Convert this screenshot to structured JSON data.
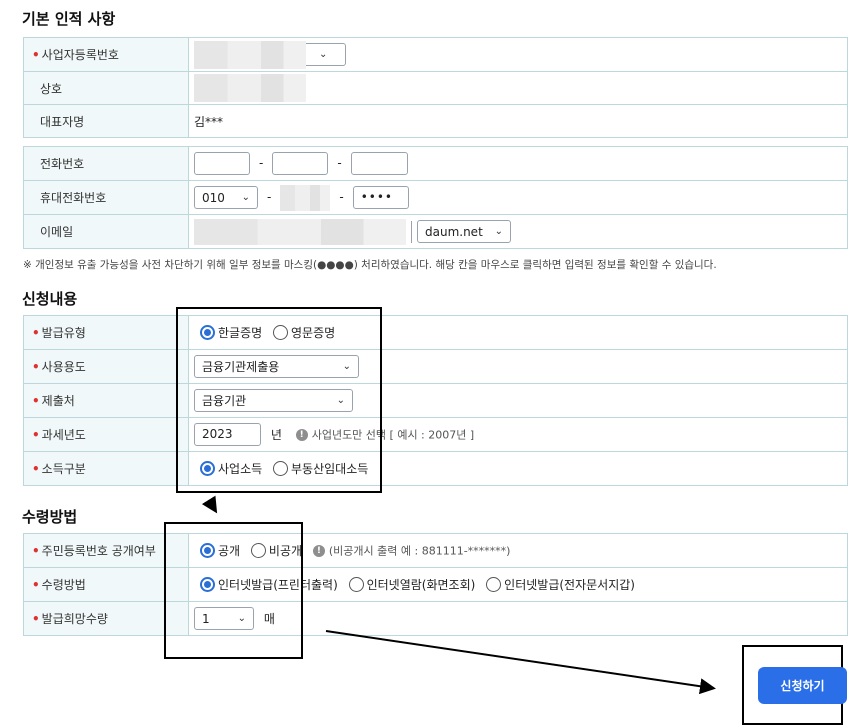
{
  "sections": {
    "basic": "기본 인적 사항",
    "request": "신청내용",
    "receive": "수령방법"
  },
  "basic": {
    "biz_no_label": "사업자등록번호",
    "company_label": "상호",
    "ceo_label": "대표자명",
    "ceo_value": "김***"
  },
  "contact": {
    "phone_label": "전화번호",
    "mobile_label": "휴대전화번호",
    "mobile_prefix": "010",
    "mobile_last": "••••",
    "email_label": "이메일",
    "email_domain": "daum.net",
    "dash": "-"
  },
  "notice": "※ 개인정보 유출 가능성을 사전 차단하기 위해 일부 정보를 마스킹(●●●●) 처리하였습니다. 해당 칸을 마우스로 클릭하면 입력된 정보를 확인할 수 있습니다.",
  "request": {
    "type_label": "발급유형",
    "type_opt1": "한글증명",
    "type_opt2": "영문증명",
    "usage_label": "사용용도",
    "usage_value": "금융기관제출용",
    "submit_to_label": "제출처",
    "submit_to_value": "금융기관",
    "year_label": "과세년도",
    "year_value": "2023",
    "year_unit": "년",
    "year_hint": "사업년도만 선택 [ 예시 : 2007년 ]",
    "income_label": "소득구분",
    "income_opt1": "사업소득",
    "income_opt2": "부동산임대소득"
  },
  "receive": {
    "disclose_label": "주민등록번호 공개여부",
    "disclose_opt1": "공개",
    "disclose_opt2": "비공개",
    "disclose_hint": "(비공개시 출력 예 : 881111-*******)",
    "method_label": "수령방법",
    "method_opt1": "인터넷발급(프린터출력)",
    "method_opt2": "인터넷열람(화면조회)",
    "method_opt3": "인터넷발급(전자문서지갑)",
    "qty_label": "발급희망수량",
    "qty_value": "1",
    "qty_unit": "매"
  },
  "submit_label": "신청하기",
  "required_mark": "•",
  "icons": {
    "select": "chevron-down-icon",
    "info": "info-icon"
  },
  "colors": {
    "accent": "#2a6fe8",
    "header_bg": "#f1f8f9",
    "border": "#bcd8dd",
    "required": "#e03030"
  }
}
